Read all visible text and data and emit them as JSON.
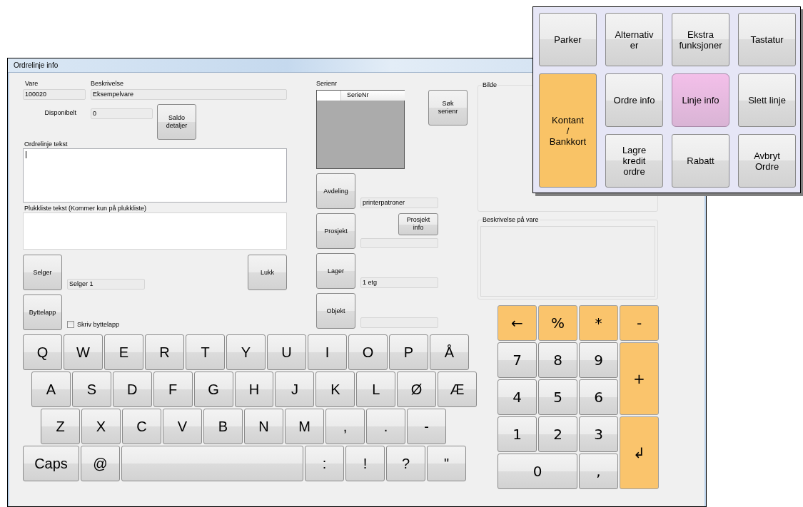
{
  "window": {
    "title": "Ordrelinje info"
  },
  "item": {
    "vare_label": "Vare",
    "vare_value": "100020",
    "beskrivelse_label": "Beskrivelse",
    "beskrivelse_value": "Eksempelvare",
    "disponibelt_label": "Disponibelt",
    "disponibelt_value": "0",
    "saldo_button": "Saldo detaljer"
  },
  "ordrelinje_tekst": {
    "label": "Ordrelinje tekst"
  },
  "plukkliste_tekst": {
    "label": "Plukkliste tekst (Kommer kun på plukkliste)"
  },
  "selger": {
    "button": "Selger",
    "value": "Selger 1"
  },
  "lukk_button": "Lukk",
  "byttelapp": {
    "button": "Byttelapp",
    "checkbox_label": "Skriv byttelapp",
    "checked": false
  },
  "serienr": {
    "label": "Serienr",
    "column": "SerieNr",
    "search_button": "Søk serienr"
  },
  "assignments": [
    {
      "button": "Avdeling",
      "value": "printerpatroner"
    },
    {
      "button": "Prosjekt",
      "info_button": "Prosjekt info"
    },
    {
      "button": "Lager",
      "value": "1 etg"
    },
    {
      "button": "Objekt"
    }
  ],
  "bilde": {
    "label": "Bilde"
  },
  "beskrivelse_paa_vare": {
    "label": "Beskrivelse på vare"
  },
  "keyboard": {
    "rows": [
      [
        "Q",
        "W",
        "E",
        "R",
        "T",
        "Y",
        "U",
        "I",
        "O",
        "P",
        "Å"
      ],
      [
        "A",
        "S",
        "D",
        "F",
        "G",
        "H",
        "J",
        "K",
        "L",
        "Ø",
        "Æ"
      ],
      [
        "Z",
        "X",
        "C",
        "V",
        "B",
        "N",
        "M",
        ",",
        ".",
        "-"
      ]
    ],
    "bottom_row": [
      {
        "kind": "wide",
        "label": "Caps"
      },
      {
        "kind": "key",
        "label": "@"
      },
      {
        "kind": "space"
      },
      {
        "kind": "key",
        "label": ":"
      },
      {
        "kind": "key",
        "label": "!"
      },
      {
        "kind": "key",
        "label": "?"
      },
      {
        "kind": "key",
        "label": "\""
      }
    ]
  },
  "numpad": [
    {
      "label": "←",
      "kind": "operator"
    },
    {
      "label": "%",
      "kind": "operator"
    },
    {
      "label": "*",
      "kind": "operator"
    },
    {
      "label": "-",
      "kind": "operator"
    },
    {
      "label": "7",
      "kind": "digit"
    },
    {
      "label": "8",
      "kind": "digit"
    },
    {
      "label": "9",
      "kind": "digit"
    },
    {
      "label": "+",
      "kind": "tall"
    },
    {
      "label": "4",
      "kind": "digit"
    },
    {
      "label": "5",
      "kind": "digit"
    },
    {
      "label": "6",
      "kind": "digit"
    },
    {
      "label": "1",
      "kind": "digit"
    },
    {
      "label": "2",
      "kind": "digit"
    },
    {
      "label": "3",
      "kind": "digit"
    },
    {
      "label": "↲",
      "kind": "tall"
    },
    {
      "label": "0",
      "kind": "wide"
    },
    {
      "label": ",",
      "kind": "digit"
    }
  ],
  "function_panel": [
    {
      "label": "Parker",
      "kind": "function",
      "selected": false
    },
    {
      "label": "Alternativ\ner",
      "kind": "function",
      "selected": false
    },
    {
      "label": "Ekstra funksjoner",
      "kind": "function",
      "selected": false
    },
    {
      "label": "Tastatur",
      "kind": "function",
      "selected": false
    },
    {
      "label": "Kontant\n/\nBankkort",
      "kind": "payment",
      "selected": false
    },
    {
      "label": "Ordre info",
      "kind": "function",
      "selected": false
    },
    {
      "label": "Linje info",
      "kind": "function",
      "selected": true
    },
    {
      "label": "Slett linje",
      "kind": "function",
      "selected": false
    },
    {
      "label": "Lagre\nkredit\nordre",
      "kind": "function",
      "selected": false
    },
    {
      "label": "Rabatt",
      "kind": "function",
      "selected": false
    },
    {
      "label": "Avbryt\nOrdre",
      "kind": "function",
      "selected": false
    }
  ]
}
